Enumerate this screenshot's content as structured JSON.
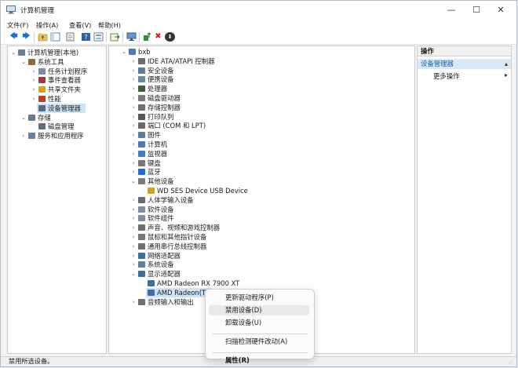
{
  "window": {
    "title": "计算机管理",
    "minimize": "—",
    "maximize": "☐",
    "close": "✕"
  },
  "menu": [
    "文件(F)",
    "操作(A)",
    "查看(V)",
    "帮助(H)"
  ],
  "toolbar": {
    "buttons": [
      "back-arrow-icon",
      "forward-arrow-icon",
      "up-folder-icon",
      "tree-toggle-icon",
      "properties-icon",
      "help-icon",
      "view-icon",
      "export-icon",
      "monitor-icon",
      "update-driver-icon",
      "uninstall-icon",
      "scan-icon"
    ],
    "back": "🡄",
    "forward": "🡆",
    "uninstall": "✖",
    "scan": "⬇"
  },
  "left_tree": [
    {
      "label": "计算机管理(本地)",
      "level": 0,
      "expander": "⌄",
      "icon": "computer-management-icon",
      "color": "#6b7f99"
    },
    {
      "label": "系统工具",
      "level": 1,
      "expander": "⌄",
      "icon": "tools-icon",
      "color": "#8a6d3b"
    },
    {
      "label": "任务计划程序",
      "level": 2,
      "expander": "›",
      "icon": "clock-icon",
      "color": "#7a8ca5"
    },
    {
      "label": "事件查看器",
      "level": 2,
      "expander": "›",
      "icon": "event-viewer-icon",
      "color": "#a33a3a"
    },
    {
      "label": "共享文件夹",
      "level": 2,
      "expander": "›",
      "icon": "shared-folder-icon",
      "color": "#d9a21b"
    },
    {
      "label": "性能",
      "level": 2,
      "expander": "›",
      "icon": "performance-icon",
      "color": "#c0392b"
    },
    {
      "label": "设备管理器",
      "level": 2,
      "expander": "",
      "icon": "device-manager-icon",
      "color": "#5a6b80",
      "selected": true
    },
    {
      "label": "存储",
      "level": 1,
      "expander": "⌄",
      "icon": "storage-icon",
      "color": "#6a7b8c"
    },
    {
      "label": "磁盘管理",
      "level": 2,
      "expander": "",
      "icon": "disk-management-icon",
      "color": "#5f6f7f"
    },
    {
      "label": "服务和应用程序",
      "level": 1,
      "expander": "›",
      "icon": "services-icon",
      "color": "#6b7f99"
    }
  ],
  "device_tree": [
    {
      "label": "bxb",
      "level": 0,
      "expander": "⌄",
      "icon": "computer-icon",
      "color": "#4a7ab8"
    },
    {
      "label": "IDE ATA/ATAPI 控制器",
      "level": 1,
      "expander": "›",
      "icon": "ide-controller-icon",
      "color": "#6b6b6b"
    },
    {
      "label": "安全设备",
      "level": 1,
      "expander": "›",
      "icon": "security-device-icon",
      "color": "#5a7a9a"
    },
    {
      "label": "便携设备",
      "level": 1,
      "expander": "›",
      "icon": "portable-device-icon",
      "color": "#6a8aa8"
    },
    {
      "label": "处理器",
      "level": 1,
      "expander": "›",
      "icon": "processor-icon",
      "color": "#3f5f3f"
    },
    {
      "label": "磁盘驱动器",
      "level": 1,
      "expander": "›",
      "icon": "disk-drive-icon",
      "color": "#7a7a7a"
    },
    {
      "label": "存储控制器",
      "level": 1,
      "expander": "›",
      "icon": "storage-controller-icon",
      "color": "#6f6f6f"
    },
    {
      "label": "打印队列",
      "level": 1,
      "expander": "›",
      "icon": "printer-icon",
      "color": "#555555"
    },
    {
      "label": "端口 (COM 和 LPT)",
      "level": 1,
      "expander": "›",
      "icon": "port-icon",
      "color": "#6a6a6a"
    },
    {
      "label": "固件",
      "level": 1,
      "expander": "›",
      "icon": "firmware-icon",
      "color": "#5f7f9f"
    },
    {
      "label": "计算机",
      "level": 1,
      "expander": "›",
      "icon": "computer-icon",
      "color": "#4a7ab8"
    },
    {
      "label": "监视器",
      "level": 1,
      "expander": "›",
      "icon": "monitor-icon",
      "color": "#3f7fbf"
    },
    {
      "label": "键盘",
      "level": 1,
      "expander": "›",
      "icon": "keyboard-icon",
      "color": "#777777"
    },
    {
      "label": "蓝牙",
      "level": 1,
      "expander": "›",
      "icon": "bluetooth-icon",
      "color": "#1f6fd0"
    },
    {
      "label": "其他设备",
      "level": 1,
      "expander": "⌄",
      "icon": "other-device-icon",
      "color": "#7a7a7a"
    },
    {
      "label": "WD SES Device USB Device",
      "level": 2,
      "expander": "",
      "icon": "unknown-device-warning-icon",
      "color": "#c9a227"
    },
    {
      "label": "人体学输入设备",
      "level": 1,
      "expander": "›",
      "icon": "hid-icon",
      "color": "#6a6a6a"
    },
    {
      "label": "软件设备",
      "level": 1,
      "expander": "›",
      "icon": "software-device-icon",
      "color": "#7f8f9f"
    },
    {
      "label": "软件组件",
      "level": 1,
      "expander": "›",
      "icon": "software-component-icon",
      "color": "#7f8f9f"
    },
    {
      "label": "声音、视频和游戏控制器",
      "level": 1,
      "expander": "›",
      "icon": "sound-icon",
      "color": "#6f6f6f"
    },
    {
      "label": "鼠标和其他指针设备",
      "level": 1,
      "expander": "›",
      "icon": "mouse-icon",
      "color": "#777777"
    },
    {
      "label": "通用串行总线控制器",
      "level": 1,
      "expander": "›",
      "icon": "usb-icon",
      "color": "#6f6f6f"
    },
    {
      "label": "网络适配器",
      "level": 1,
      "expander": "›",
      "icon": "network-adapter-icon",
      "color": "#3f6f9f"
    },
    {
      "label": "系统设备",
      "level": 1,
      "expander": "›",
      "icon": "system-device-icon",
      "color": "#5f7f9f"
    },
    {
      "label": "显示适配器",
      "level": 1,
      "expander": "⌄",
      "icon": "display-adapter-icon",
      "color": "#3f6f9f"
    },
    {
      "label": "AMD Radeon RX 7900 XT",
      "level": 2,
      "expander": "",
      "icon": "display-adapter-icon",
      "color": "#3f6f9f"
    },
    {
      "label": "AMD Radeon(TM) Graphics",
      "level": 2,
      "expander": "",
      "icon": "display-adapter-icon",
      "color": "#3f6f9f",
      "selected": true
    },
    {
      "label": "音频输入和输出",
      "level": 1,
      "expander": "›",
      "icon": "audio-io-icon",
      "color": "#6f6f6f"
    }
  ],
  "actions": {
    "header": "操作",
    "selected": "设备管理器",
    "more": "更多操作",
    "arrow_up": "▴",
    "arrow_right": "▸"
  },
  "context_menu": [
    {
      "label": "更新驱动程序(P)",
      "bold": false
    },
    {
      "label": "禁用设备(D)",
      "bold": false,
      "highlighted": true
    },
    {
      "label": "卸载设备(U)",
      "bold": false
    },
    {
      "separator": true
    },
    {
      "label": "扫描检测硬件改动(A)",
      "bold": false
    },
    {
      "separator": true
    },
    {
      "label": "属性(R)",
      "bold": true
    }
  ],
  "status": "禁用所选设备。",
  "colors": {
    "selection": "#cce4f7",
    "action_selected": "#d9e8f5",
    "accent": "#0b5bab"
  }
}
